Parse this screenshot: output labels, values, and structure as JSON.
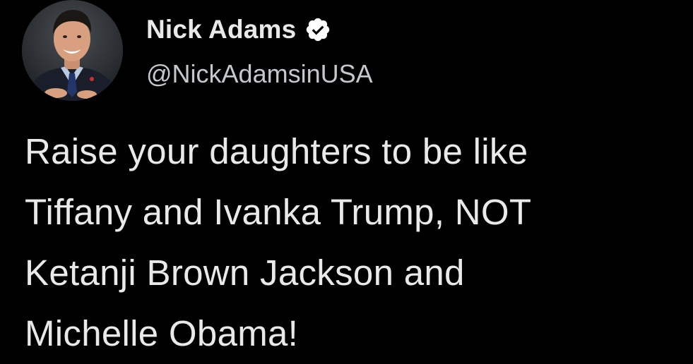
{
  "colors": {
    "background": "#000000",
    "text_primary": "#e7e9ea",
    "text_secondary": "#c4c8cc",
    "verified_badge": "#ffffff"
  },
  "author": {
    "display_name": "Nick Adams",
    "handle": "@NickAdamsinUSA",
    "verified_icon": "verified-badge-icon",
    "avatar_icon": "profile-photo"
  },
  "tweet": {
    "lines": [
      "Raise your daughters to be like",
      "Tiffany and Ivanka Trump, NOT",
      "Ketanji Brown Jackson and",
      "Michelle Obama!"
    ]
  }
}
